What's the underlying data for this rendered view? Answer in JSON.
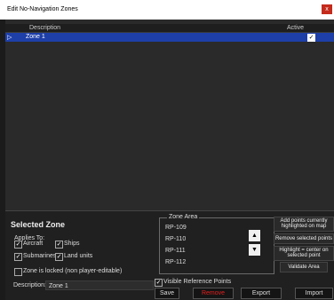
{
  "window": {
    "title": "Edit No-Navigation Zones",
    "close_glyph": "x"
  },
  "grid": {
    "columns": [
      "Description",
      "Active"
    ],
    "rows": [
      {
        "description": "Zone 1",
        "active": "✓"
      }
    ],
    "row_indicator": "▷"
  },
  "selected_zone": {
    "heading": "Selected Zone",
    "applies_to_label": "Applies To:",
    "applies": {
      "aircraft": {
        "label": "Aircraft",
        "check": "✓"
      },
      "ships": {
        "label": "Ships",
        "check": "✓"
      },
      "submarines": {
        "label": "Submarines",
        "check": "✓"
      },
      "land_units": {
        "label": "Land units",
        "check": "✓"
      }
    },
    "locked_label": "Zone is locked (non player-editable)",
    "description_label": "Description:",
    "description_value": "Zone 1"
  },
  "zone_area": {
    "legend": "Zone Area",
    "points": [
      "RP-109",
      "RP-110",
      "RP-111",
      "RP-112"
    ],
    "up_glyph": "▲",
    "down_glyph": "▼"
  },
  "right_buttons": {
    "add_points": "Add points currently highlighted on map",
    "remove_points": "Remove selected points",
    "highlight": "Highlight = center on selected point",
    "validate": "Validate Area"
  },
  "visible_ref_points": {
    "label": "Visible Reference Points",
    "check": "✓"
  },
  "footer": {
    "save": "Save",
    "remove": "Remove",
    "export": "Export",
    "import": "Import"
  },
  "colors": {
    "selected_row": "#1e3fa8",
    "remove_text": "#e02020",
    "close_bg": "#c42b1c"
  }
}
